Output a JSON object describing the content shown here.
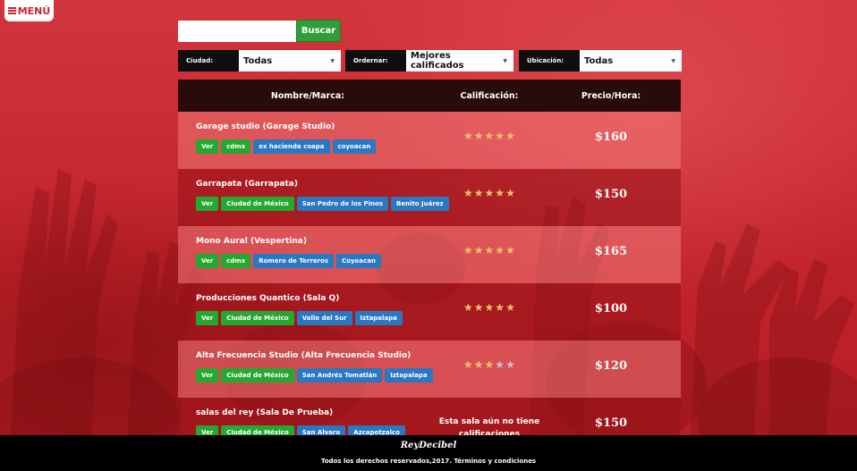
{
  "menu": {
    "label": "MENÚ",
    "icon": "hamburger-icon"
  },
  "search": {
    "placeholder": "",
    "value": "",
    "button_label": "Buscar"
  },
  "filters": [
    {
      "label": "Ciudad:",
      "value": "Todas"
    },
    {
      "label": "Ordernar:",
      "value": "Mejores calificados"
    },
    {
      "label": "Ubicación:",
      "value": "Todas"
    }
  ],
  "table": {
    "headers": {
      "name": "Nombre/Marca:",
      "rating": "Calificación:",
      "price": "Precio/Hora:"
    },
    "rows": [
      {
        "name": "Garage studio (Garage Studio)",
        "tags": [
          "Ver",
          "cdmx",
          "ex hacienda coapa",
          "coyoacan"
        ],
        "rating": 5,
        "price": "$160"
      },
      {
        "name": "Garrapata (Garrapata)",
        "tags": [
          "Ver",
          "Ciudad de México",
          "San Pedro de los Pinos",
          "Benito Juárez"
        ],
        "rating": 5,
        "price": "$150"
      },
      {
        "name": "Mono Aural (Vespertina)",
        "tags": [
          "Ver",
          "cdmx",
          "Romero de Terreros",
          "Coyoacan"
        ],
        "rating": 5,
        "price": "$165"
      },
      {
        "name": "Producciones Quantico (Sala Q)",
        "tags": [
          "Ver",
          "Ciudad de México",
          "Valle del Sur",
          "Iztapalapa"
        ],
        "rating": 5,
        "price": "$100"
      },
      {
        "name": "Alta Frecuencia Studio (Alta Frecuencia Studio)",
        "tags": [
          "Ver",
          "Ciudad de México",
          "San Andrés Tomatlán",
          "Iztapalapa"
        ],
        "rating": 3,
        "price": "$120"
      },
      {
        "name": "salas del rey (Sala De Prueba)",
        "tags": [
          "Ver",
          "Ciudad de México",
          "San Alvaro",
          "Azcapotzalco"
        ],
        "rating": null,
        "no_rating_text": "Esta sala aún no tiene calificaciones",
        "price": "$150"
      }
    ]
  },
  "footer": {
    "brand": "ReyDecibel",
    "legal": "Todos los derechos reservados,2017. Términos y condiciones"
  },
  "colors": {
    "brand_red": "#c8252c",
    "tag_green": "#25a831",
    "tag_blue": "#2a77c2",
    "star_gold": "#f2c46a",
    "header_dark": "#2a0b0b"
  }
}
